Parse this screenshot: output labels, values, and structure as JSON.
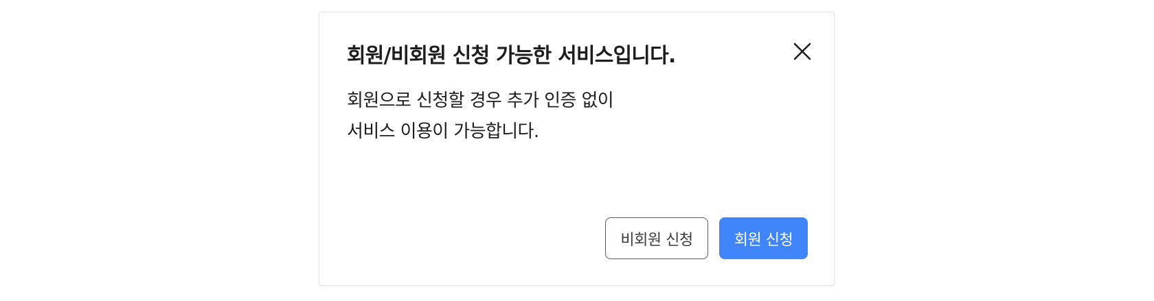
{
  "dialog": {
    "title": "회원/비회원 신청 가능한 서비스입니다.",
    "close_icon": "close-icon",
    "message_lines": [
      "회원으로 신청할 경우 추가 인증 없이",
      "서비스 이용이 가능합니다."
    ],
    "buttons": {
      "non_member_label": "비회원 신청",
      "member_label": "회원 신청"
    }
  },
  "colors": {
    "primary": "#3f84f8",
    "text": "#1d1d1d",
    "secondary_border": "#5a5a5a"
  }
}
